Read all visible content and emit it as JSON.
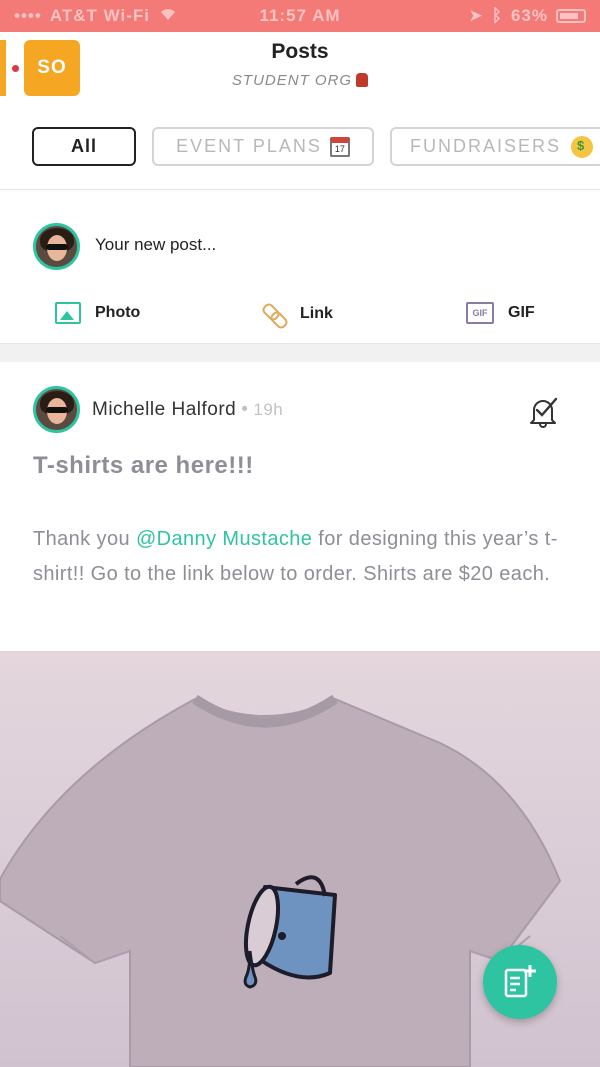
{
  "status_bar": {
    "carrier": "AT&T Wi-Fi",
    "time": "11:57 AM",
    "battery": "63%"
  },
  "header": {
    "org_initials": "SO",
    "title": "Posts",
    "subtitle": "STUDENT ORG"
  },
  "filters": [
    {
      "label": "All",
      "selected": true
    },
    {
      "label": "EVENT PLANS",
      "selected": false
    },
    {
      "label": "FUNDRAISERS",
      "selected": false
    }
  ],
  "composer": {
    "placeholder": "Your new post...",
    "actions": {
      "photo": "Photo",
      "link": "Link",
      "gif": "GIF",
      "gif_icon_text": "GIF"
    }
  },
  "post": {
    "author": "Michelle Halford",
    "separator": "•",
    "time": "19h",
    "title": "T-shirts are here!!!",
    "body_before": "Thank you ",
    "mention": "@Danny Mustache",
    "body_after": " for designing this year’s t-shirt!! Go to the link below to order. Shirts are $20 each."
  },
  "colors": {
    "accent": "#2ec4a2",
    "org": "#f5a623",
    "status_bar": "#f47a78"
  },
  "icons": [
    "wifi-icon",
    "battery-icon",
    "backpack-icon",
    "calendar-icon",
    "money-face-icon",
    "photo-icon",
    "link-icon",
    "gif-icon",
    "bell-check-icon",
    "new-post-icon"
  ]
}
